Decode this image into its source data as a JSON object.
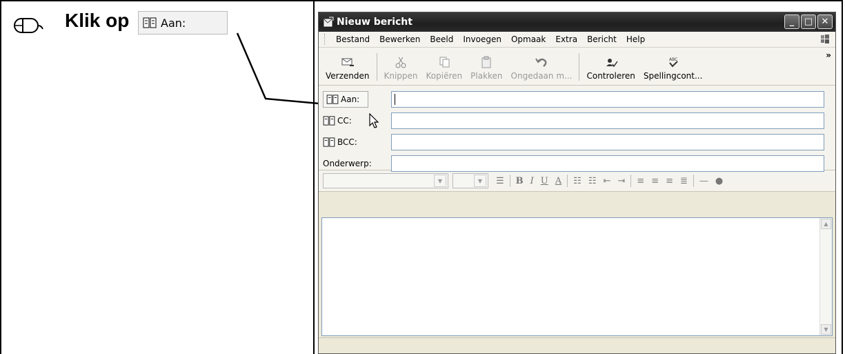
{
  "instruction": {
    "text": "Klik op",
    "button_label": "Aan:"
  },
  "window": {
    "title": "Nieuw bericht",
    "controls": [
      "minimize",
      "maximize",
      "close"
    ]
  },
  "menu": [
    "Bestand",
    "Bewerken",
    "Beeld",
    "Invoegen",
    "Opmaak",
    "Extra",
    "Bericht",
    "Help"
  ],
  "toolbar": [
    {
      "label": "Verzenden",
      "icon": "send-icon",
      "enabled": true
    },
    {
      "label": "Knippen",
      "icon": "scissors-icon",
      "enabled": false
    },
    {
      "label": "Kopiëren",
      "icon": "copy-icon",
      "enabled": false
    },
    {
      "label": "Plakken",
      "icon": "paste-icon",
      "enabled": false
    },
    {
      "label": "Ongedaan m...",
      "icon": "undo-icon",
      "enabled": false
    },
    {
      "label": "Controleren",
      "icon": "check-names-icon",
      "enabled": true
    },
    {
      "label": "Spellingcont...",
      "icon": "spelling-icon",
      "enabled": true
    }
  ],
  "fields": {
    "to_label": "Aan:",
    "cc_label": "CC:",
    "bcc_label": "BCC:",
    "subject_label": "Onderwerp:"
  },
  "format_bar": {
    "buttons": [
      "B",
      "I",
      "U",
      "A"
    ]
  }
}
